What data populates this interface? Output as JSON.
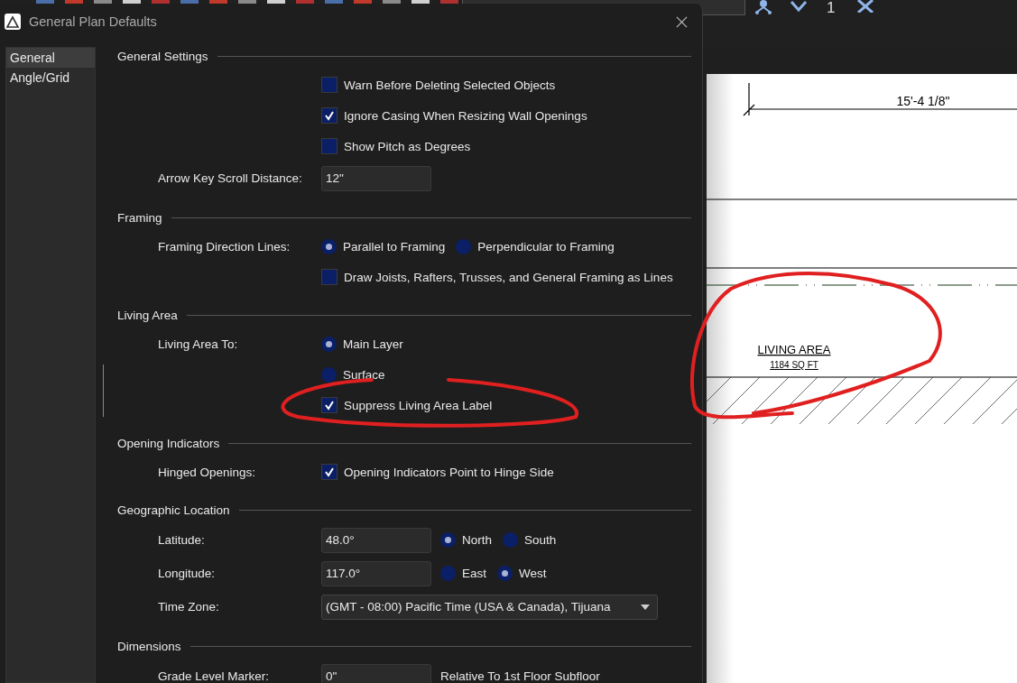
{
  "app_toolbar": {
    "counter": "1"
  },
  "window": {
    "title": "General Plan Defaults"
  },
  "sidebar": {
    "items": [
      {
        "label": "General",
        "selected": true
      },
      {
        "label": "Angle/Grid",
        "selected": false
      }
    ]
  },
  "sections": [
    {
      "title": "General Settings",
      "rows": [
        {
          "kind": "checkbox",
          "text": "Warn Before Deleting Selected Objects",
          "checked": false
        },
        {
          "kind": "checkbox",
          "text": "Ignore Casing When Resizing Wall Openings",
          "checked": true
        },
        {
          "kind": "checkbox",
          "text": "Show Pitch as Degrees",
          "checked": false
        },
        {
          "kind": "field",
          "label": "Arrow Key Scroll Distance:",
          "value": "12\""
        }
      ]
    },
    {
      "title": "Framing",
      "rows": [
        {
          "kind": "radios",
          "label": "Framing Direction Lines:",
          "options": [
            {
              "text": "Parallel to Framing",
              "selected": true
            },
            {
              "text": "Perpendicular to Framing",
              "selected": false
            }
          ]
        },
        {
          "kind": "checkbox",
          "text": "Draw Joists, Rafters, Trusses, and General Framing as Lines",
          "checked": false
        }
      ]
    },
    {
      "title": "Living Area",
      "rows": [
        {
          "kind": "radios",
          "label": "Living Area To:",
          "options": [
            {
              "text": "Main Layer",
              "selected": true
            }
          ]
        },
        {
          "kind": "radios",
          "options": [
            {
              "text": "Surface",
              "selected": false
            }
          ]
        },
        {
          "kind": "checkbox",
          "text": "Suppress Living Area Label",
          "checked": true
        }
      ]
    },
    {
      "title": "Opening Indicators",
      "rows": [
        {
          "kind": "checkbox",
          "label": "Hinged Openings:",
          "text": "Opening Indicators Point to Hinge Side",
          "checked": true
        }
      ]
    },
    {
      "title": "Geographic Location",
      "rows": [
        {
          "kind": "field",
          "label": "Latitude:",
          "value": "48.0°",
          "options": [
            {
              "text": "North",
              "selected": true
            },
            {
              "text": "South",
              "selected": false
            }
          ]
        },
        {
          "kind": "field",
          "label": "Longitude:",
          "value": "117.0°",
          "options": [
            {
              "text": "East",
              "selected": false
            },
            {
              "text": "West",
              "selected": true
            }
          ]
        },
        {
          "kind": "dropdown",
          "label": "Time Zone:",
          "value": "(GMT - 08:00) Pacific Time (USA & Canada), Tijuana"
        }
      ]
    },
    {
      "title": "Dimensions",
      "rows": [
        {
          "kind": "field",
          "label": "Grade Level Marker:",
          "value": "0\"",
          "note": "Relative To 1st Floor Subfloor"
        }
      ]
    }
  ],
  "plan": {
    "dimension": "15'-4 1/8\"",
    "room_name": "LIVING AREA",
    "room_area": "1184 SQ FT"
  }
}
